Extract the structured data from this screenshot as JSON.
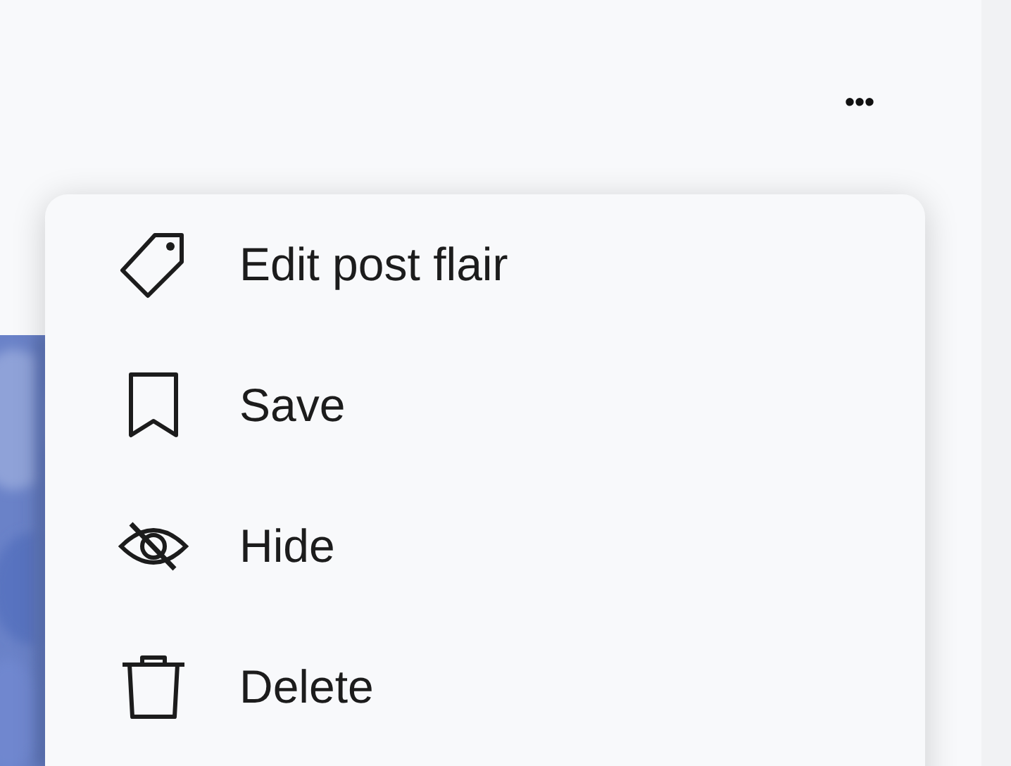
{
  "more_button": {
    "label": "•••"
  },
  "menu": {
    "items": [
      {
        "kind": "tag",
        "label": "Edit post flair"
      },
      {
        "kind": "bookmark",
        "label": "Save"
      },
      {
        "kind": "eye-off",
        "label": "Hide"
      },
      {
        "kind": "trash",
        "label": "Delete"
      }
    ]
  }
}
